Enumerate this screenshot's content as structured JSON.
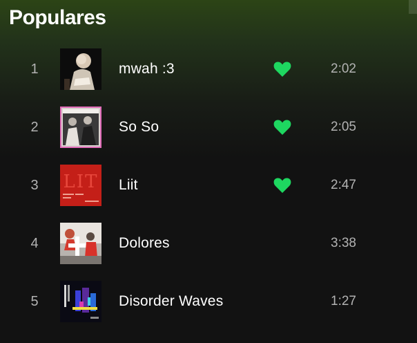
{
  "section": {
    "title": "Populares"
  },
  "colors": {
    "accent": "#1ed760",
    "muted_text": "#b3b3b3",
    "background": "#121212",
    "header_gradient_top": "#2c4416"
  },
  "tracks": [
    {
      "number": "1",
      "title": "mwah :3",
      "duration": "2:02",
      "liked": true,
      "like_icon": "heart-filled-icon"
    },
    {
      "number": "2",
      "title": "So So",
      "duration": "2:05",
      "liked": true,
      "like_icon": "heart-filled-icon"
    },
    {
      "number": "3",
      "title": "Liit",
      "duration": "2:47",
      "liked": true,
      "like_icon": "heart-filled-icon",
      "cover_text": "LIT"
    },
    {
      "number": "4",
      "title": "Dolores",
      "duration": "3:38",
      "liked": false
    },
    {
      "number": "5",
      "title": "Disorder Waves",
      "duration": "1:27",
      "liked": false
    }
  ]
}
